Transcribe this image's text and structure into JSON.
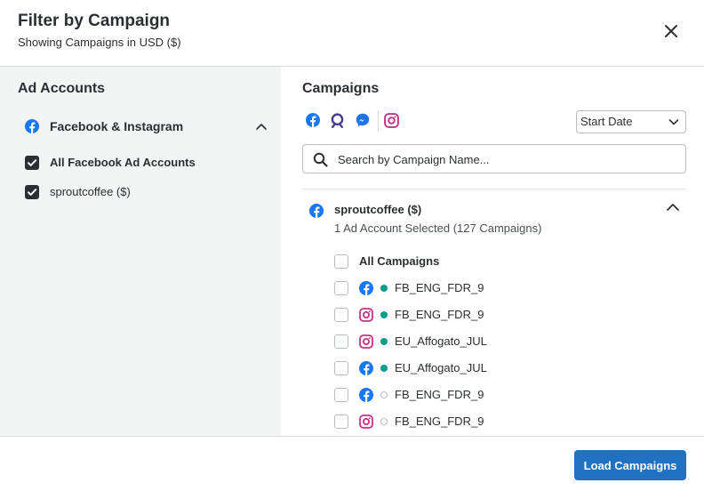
{
  "header": {
    "title": "Filter by Campaign",
    "subtitle": "Showing Campaigns in USD ($)"
  },
  "ad_accounts": {
    "title": "Ad Accounts",
    "network": "Facebook & Instagram",
    "items": [
      {
        "label": "All Facebook Ad Accounts",
        "checked": true
      },
      {
        "label": "sproutcoffee ($)",
        "checked": true
      }
    ]
  },
  "campaigns": {
    "title": "Campaigns",
    "network_filters": [
      "facebook-icon",
      "audience-icon",
      "messenger-icon",
      "instagram-icon"
    ],
    "sort": {
      "selected": "Start Date"
    },
    "search": {
      "placeholder": "Search by Campaign Name..."
    },
    "account": {
      "name": "sproutcoffee ($)",
      "summary": "1 Ad Account Selected (127 Campaigns)"
    },
    "all_label": "All Campaigns",
    "items": [
      {
        "network": "facebook",
        "status": "active",
        "name": "FB_ENG_FDR_9"
      },
      {
        "network": "instagram",
        "status": "active",
        "name": "FB_ENG_FDR_9"
      },
      {
        "network": "instagram",
        "status": "active",
        "name": "EU_Affogato_JUL"
      },
      {
        "network": "facebook",
        "status": "active",
        "name": "EU_Affogato_JUL"
      },
      {
        "network": "facebook",
        "status": "inactive",
        "name": "FB_ENG_FDR_9"
      },
      {
        "network": "instagram",
        "status": "inactive",
        "name": "FB_ENG_FDR_9"
      }
    ]
  },
  "footer": {
    "load_label": "Load Campaigns"
  },
  "colors": {
    "primary": "#2071c2",
    "facebook": "#1877f2",
    "instagram": "#c13584",
    "active_status": "#0b9e8a",
    "panel_bg": "#f3f4f4"
  }
}
